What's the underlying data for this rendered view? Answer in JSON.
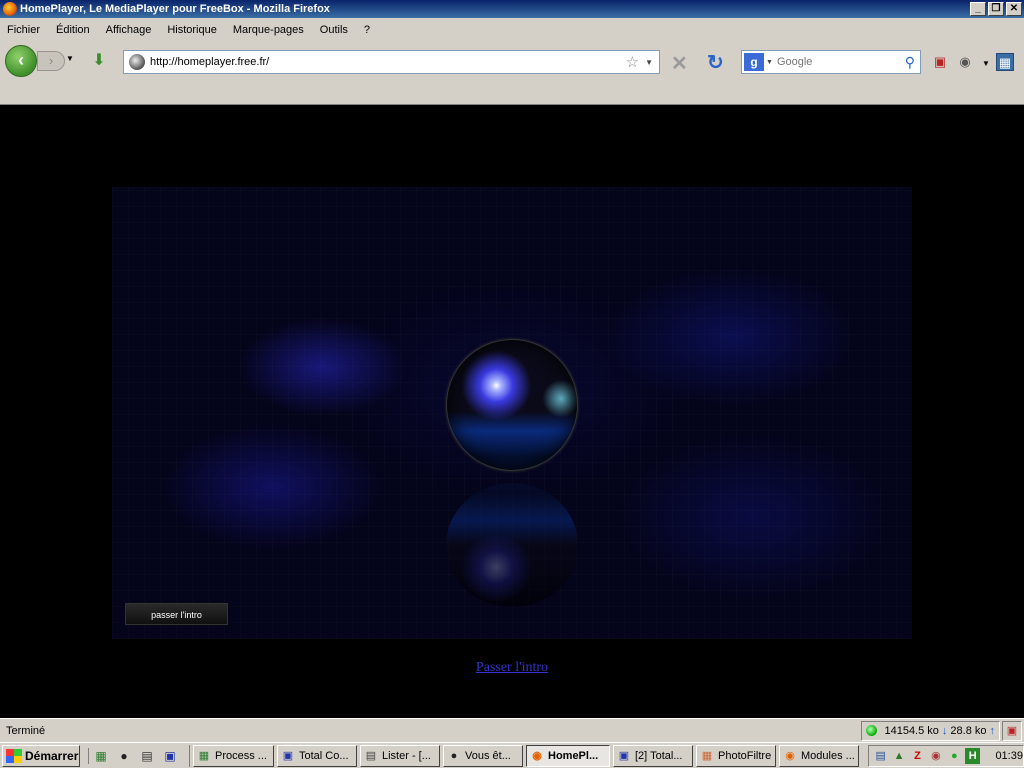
{
  "window": {
    "title": "HomePlayer, Le MediaPlayer pour FreeBox - Mozilla Firefox",
    "minimize": "_",
    "restore": "❐",
    "close": "✕"
  },
  "menu": [
    "Fichier",
    "Édition",
    "Affichage",
    "Historique",
    "Marque-pages",
    "Outils",
    "?"
  ],
  "toolbar": {
    "url": "http://homeplayer.free.fr/",
    "search_placeholder": "Google",
    "search_engine_letter": "g"
  },
  "page": {
    "skip_button": "passer l'intro",
    "skip_link": "Passer l'intro"
  },
  "status": {
    "text": "Terminé",
    "download": "14154.5 ko",
    "upload": "28.8 ko"
  },
  "taskbar": {
    "start": "Démarrer",
    "tasks": [
      "Process ...",
      "Total Co...",
      "Lister - [...",
      "Vous êt...",
      "HomePl...",
      "[2] Total...",
      "PhotoFiltre",
      "Modules ..."
    ],
    "active_task": "HomePl...",
    "clock": "01:39"
  }
}
